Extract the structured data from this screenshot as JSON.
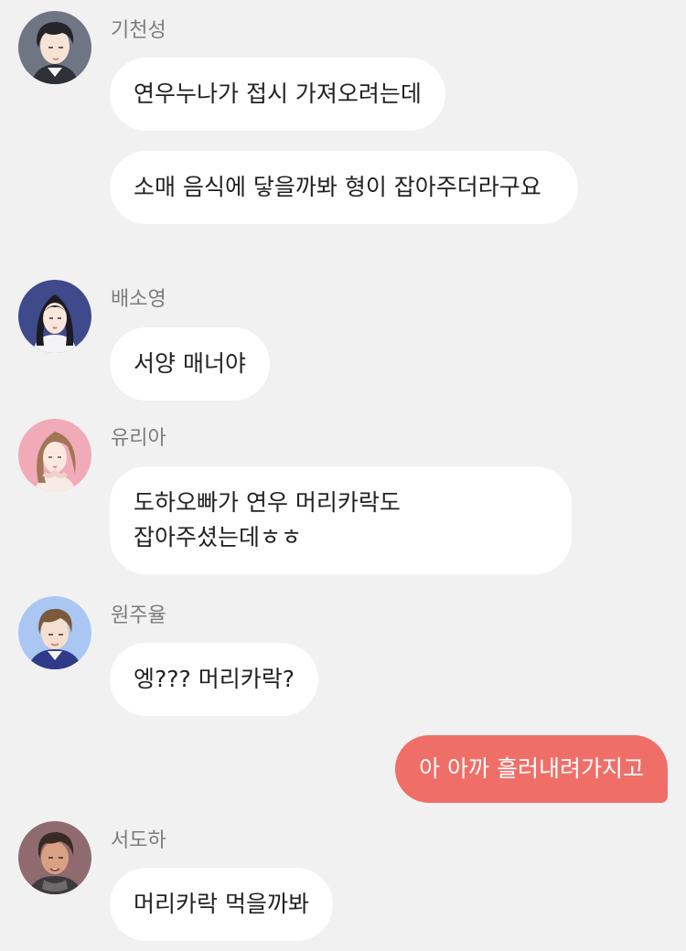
{
  "messages": [
    {
      "sender": "기천성",
      "bubbles": [
        "연우누나가 접시 가져오려는데",
        "소매 음식에 닿을까봐 형이 잡아주더라구요"
      ]
    },
    {
      "sender": "배소영",
      "bubbles": [
        "서양 매너야"
      ]
    },
    {
      "sender": "유리아",
      "bubbles": [
        "도하오빠가 연우 머리카락도 잡아주셨는데ㅎㅎ"
      ]
    },
    {
      "sender": "원주율",
      "bubbles": [
        "엥??? 머리카락?"
      ]
    },
    {
      "mine": true,
      "bubbles": [
        "아 아까 흘러내려가지고"
      ]
    },
    {
      "sender": "서도하",
      "bubbles": [
        "머리카락 먹을까봐"
      ]
    }
  ],
  "colors": {
    "background": "#f1f1f1",
    "bubble_other": "#ffffff",
    "bubble_mine": "#ef6f68",
    "sender_text": "#7c7c7c"
  },
  "icons": [
    "avatar-kicheonseong",
    "avatar-baesoyoung",
    "avatar-yuria",
    "avatar-wonjuyul",
    "avatar-seodoha"
  ]
}
